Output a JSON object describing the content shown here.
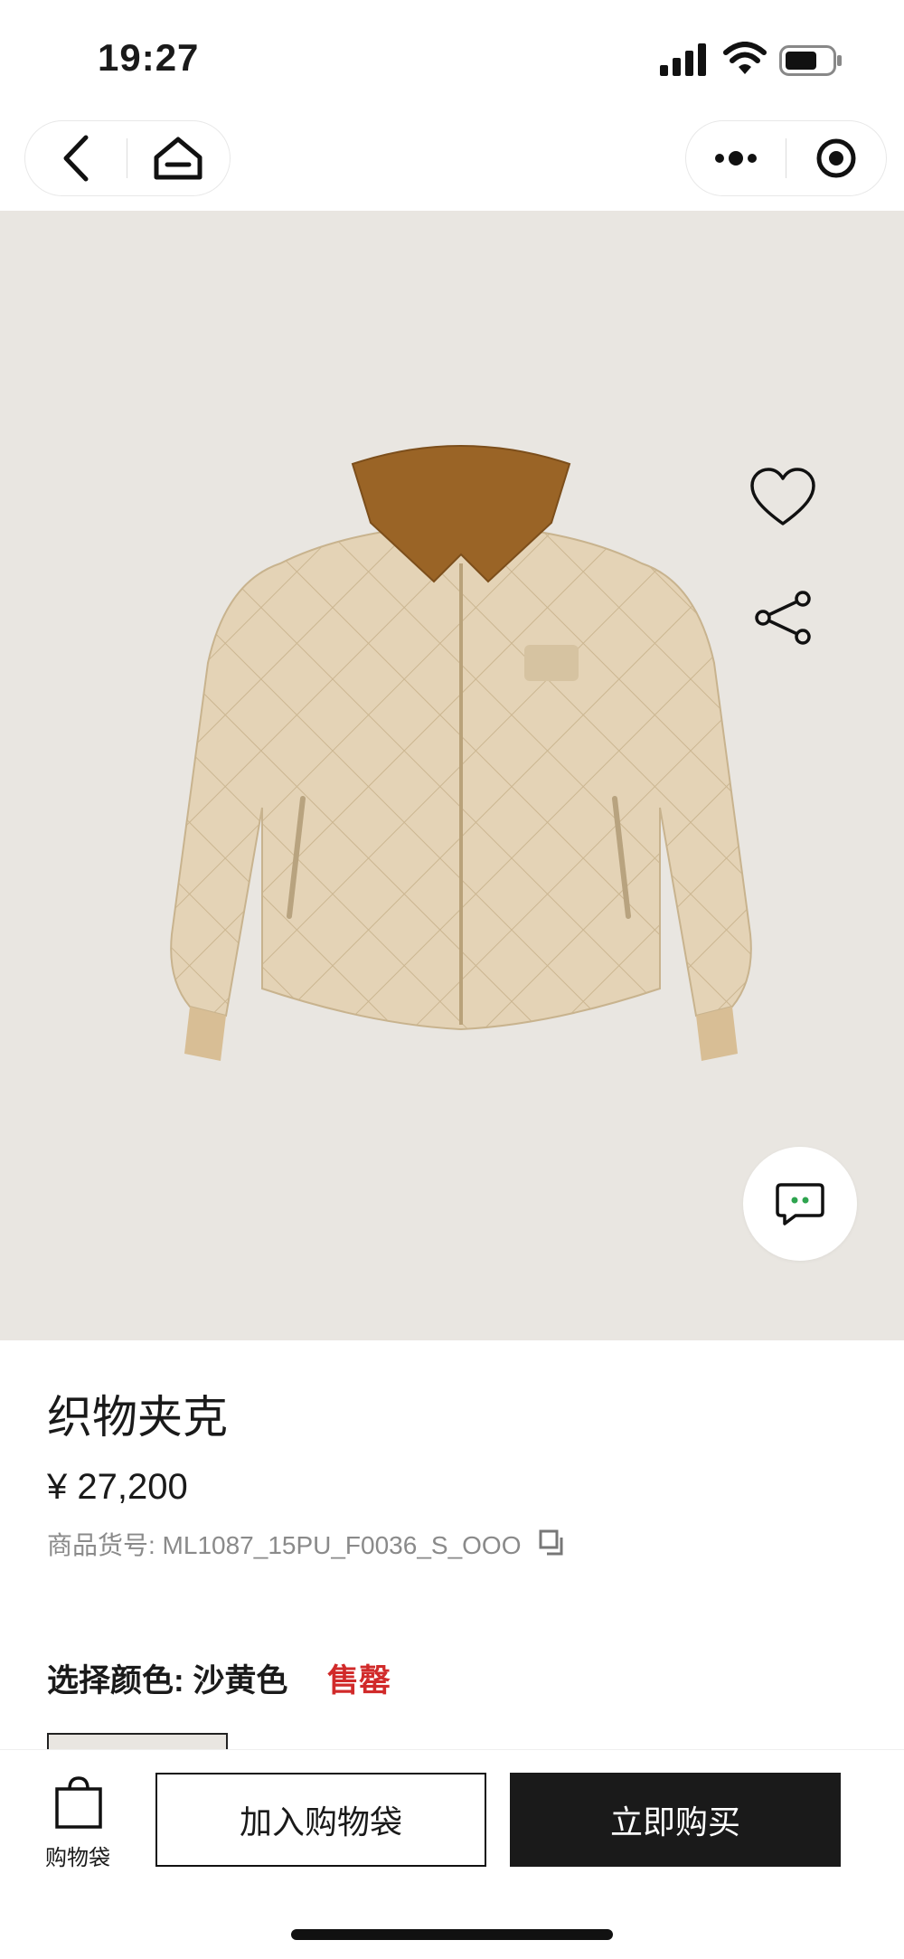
{
  "status_bar": {
    "time": "19:27"
  },
  "nav": {
    "back_icon": "chevron-left-icon",
    "home_icon": "home-icon",
    "more_icon": "more-dots-icon",
    "close_icon": "target-circle-icon"
  },
  "hero": {
    "favorite_icon": "heart-icon",
    "share_icon": "share-icon",
    "chat_icon": "chat-bubble-icon",
    "image_count": 5,
    "active_image_index": 0,
    "background_color": "#e9e6e1",
    "jacket_color": "#e4d3b6",
    "collar_color": "#9a6426"
  },
  "product": {
    "title": "织物夹克",
    "price": "¥ 27,200",
    "sku": "商品货号: ML1087_15PU_F0036_S_OOO",
    "copy_icon": "copy-icon",
    "color_label": "选择颜色: 沙黄色",
    "soldout_label": "售罄",
    "soldout_color": "#d12a2a"
  },
  "bottom_bar": {
    "bag_icon": "shopping-bag-icon",
    "bag_label": "购物袋",
    "add_to_bag": "加入购物袋",
    "buy_now": "立即购买"
  }
}
